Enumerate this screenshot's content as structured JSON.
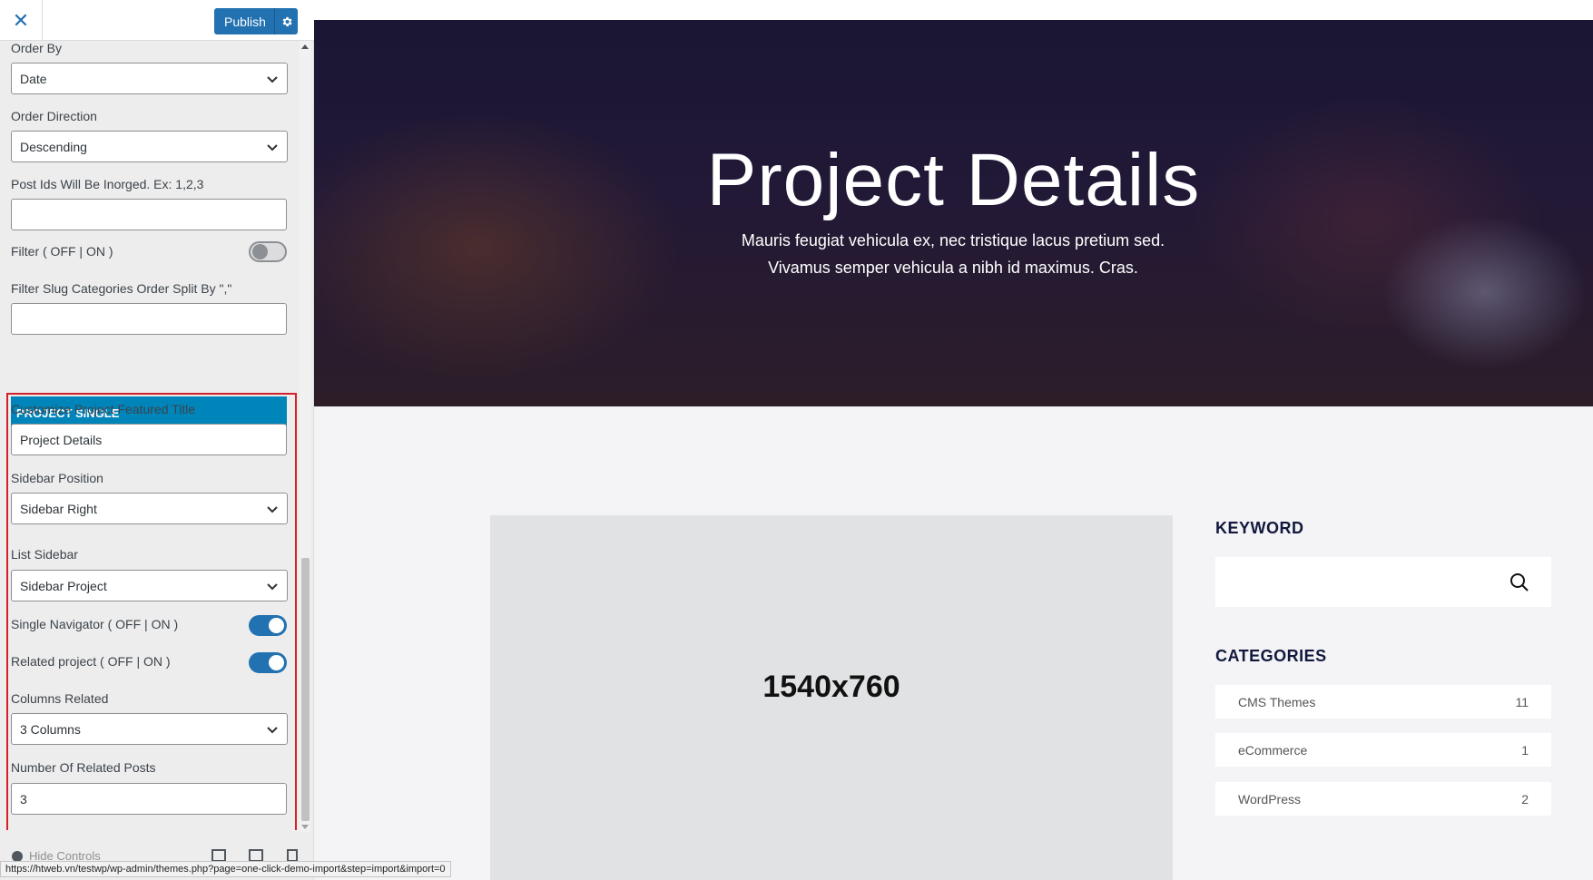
{
  "app": {
    "accent": "#2271b1",
    "highlight": "#d22128"
  },
  "header": {
    "close_icon": "close-icon",
    "publish_label": "Publish",
    "settings_icon": "gear-icon"
  },
  "controls": {
    "order_by": {
      "label": "Order By",
      "value": "Date"
    },
    "order_direction": {
      "label": "Order Direction",
      "value": "Descending"
    },
    "post_ids": {
      "label": "Post Ids Will Be Inorged. Ex: 1,2,3",
      "value": ""
    },
    "filter": {
      "label": "Filter ( OFF | ON )",
      "enabled": false
    },
    "filter_slug": {
      "label": "Filter Slug Categories Order Split By \",\"",
      "value": ""
    },
    "section_title": "PROJECT SINGLE",
    "featured_title": {
      "label": "Customize Project Featured Title",
      "value": "Project Details"
    },
    "sidebar_position": {
      "label": "Sidebar Position",
      "value": "Sidebar Right"
    },
    "list_sidebar": {
      "label": "List Sidebar",
      "value": "Sidebar Project"
    },
    "single_navigator": {
      "label": "Single Navigator ( OFF | ON )",
      "enabled": true
    },
    "related_project": {
      "label": "Related project ( OFF | ON )",
      "enabled": true
    },
    "columns_related": {
      "label": "Columns Related",
      "value": "3 Columns"
    },
    "number_related": {
      "label": "Number Of Related Posts",
      "value": "3"
    }
  },
  "footer": {
    "hide_controls": "Hide Controls"
  },
  "status_bar": {
    "url": "https://htweb.vn/testwp/wp-admin/themes.php?page=one-click-demo-import&step=import&import=0"
  },
  "preview": {
    "hero": {
      "title": "Project Details",
      "subtitle": "Mauris feugiat vehicula ex, nec tristique lacus pretium sed. Vivamus semper vehicula a nibh id maximus. Cras."
    },
    "image_placeholder": "1540x760",
    "keyword_title": "KEYWORD",
    "categories_title": "CATEGORIES",
    "categories": [
      {
        "name": "CMS Themes",
        "count": "11"
      },
      {
        "name": "eCommerce",
        "count": "1"
      },
      {
        "name": "WordPress",
        "count": "2"
      }
    ]
  }
}
